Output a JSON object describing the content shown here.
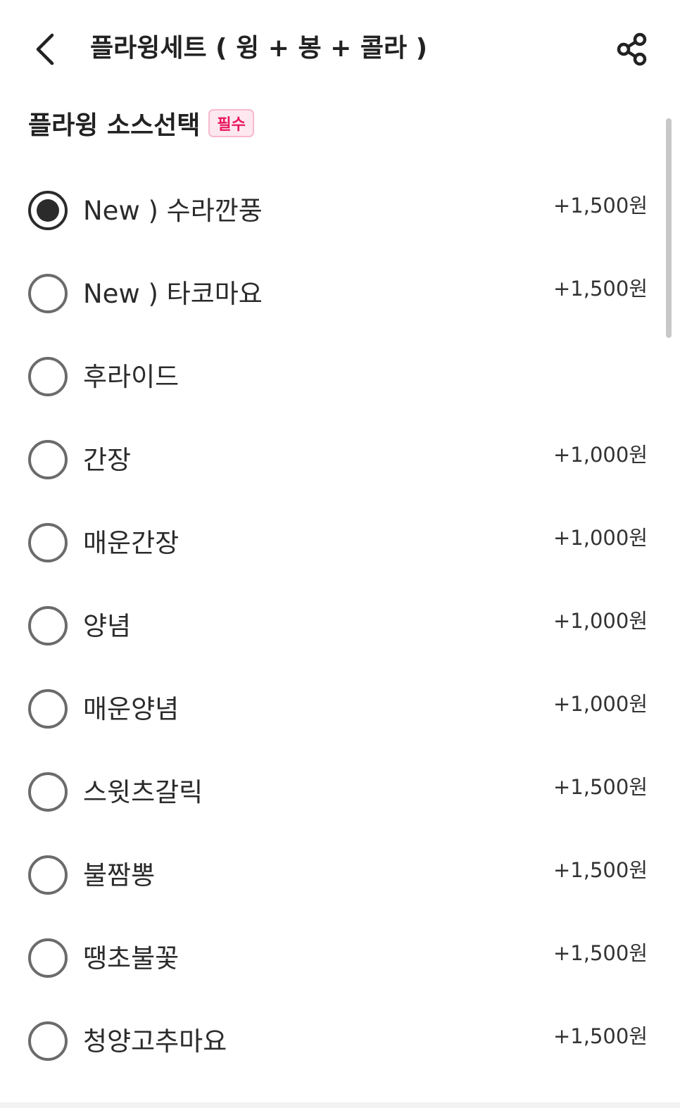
{
  "header": {
    "title": "플라윙세트 ( 윙 + 봉 + 콜라 )",
    "back_icon": "chevron-left-icon",
    "share_icon": "share-icon"
  },
  "section": {
    "title": "플라윙 소스선택",
    "badge": "필수"
  },
  "colors": {
    "badge_text": "#e8175d",
    "badge_bg": "#fde8ef",
    "badge_border": "#f7b9cc",
    "radio_border": "#6b6b6b",
    "radio_checked": "#2b2b2b"
  },
  "options": [
    {
      "label": "New ) 수라깐풍",
      "price": "+1,500원",
      "selected": true
    },
    {
      "label": "New ) 타코마요",
      "price": "+1,500원",
      "selected": false
    },
    {
      "label": "후라이드",
      "price": "",
      "selected": false
    },
    {
      "label": "간장",
      "price": "+1,000원",
      "selected": false
    },
    {
      "label": "매운간장",
      "price": "+1,000원",
      "selected": false
    },
    {
      "label": "양념",
      "price": "+1,000원",
      "selected": false
    },
    {
      "label": "매운양념",
      "price": "+1,000원",
      "selected": false
    },
    {
      "label": "스윗츠갈릭",
      "price": "+1,500원",
      "selected": false
    },
    {
      "label": "불짬뽕",
      "price": "+1,500원",
      "selected": false
    },
    {
      "label": "땡초불꽃",
      "price": "+1,500원",
      "selected": false
    },
    {
      "label": "청양고추마요",
      "price": "+1,500원",
      "selected": false
    }
  ]
}
